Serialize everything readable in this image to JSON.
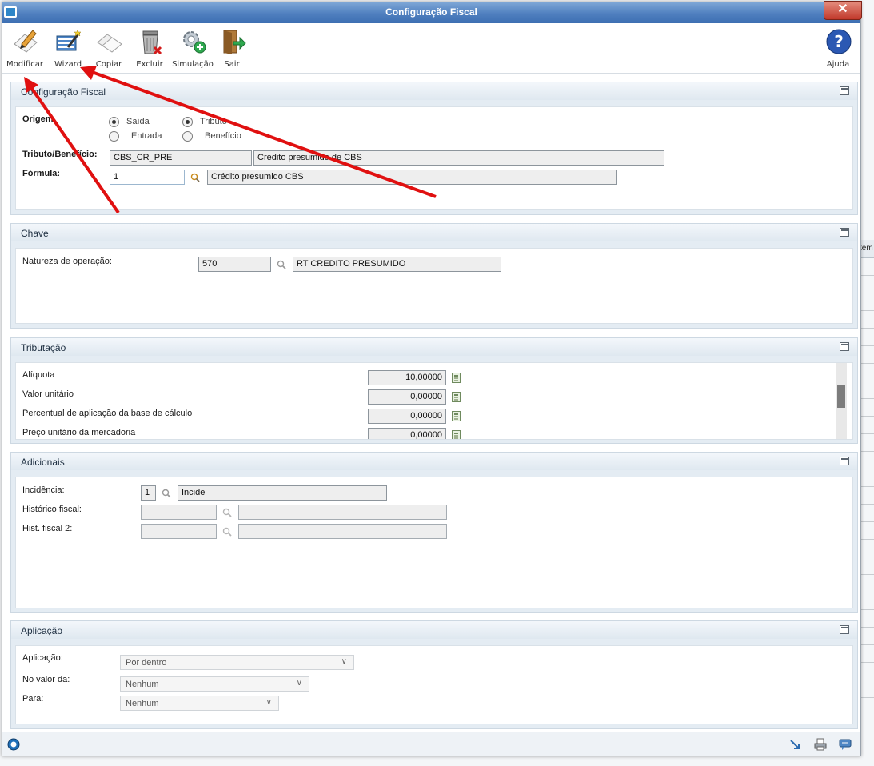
{
  "window": {
    "title": "Configuração Fiscal",
    "close_label": "✕"
  },
  "toolbar": {
    "items": [
      {
        "label": "Modificar",
        "icon": "edit-pencil-icon"
      },
      {
        "label": "Wizard",
        "icon": "wizard-wand-icon"
      },
      {
        "label": "Copiar",
        "icon": "copy-icon"
      },
      {
        "label": "Excluir",
        "icon": "trash-icon"
      },
      {
        "label": "Simulação",
        "icon": "gear-simulation-icon"
      },
      {
        "label": "Sair",
        "icon": "exit-door-icon"
      }
    ],
    "help_label": "Ajuda"
  },
  "background": {
    "right_header_fragment": "tem"
  },
  "panels": {
    "config": {
      "title": "Configuração Fiscal",
      "origem_label": "Origem",
      "radios": {
        "saida": "Saída",
        "entrada": "Entrada",
        "tributo": "Tributo",
        "beneficio": "Benefício"
      },
      "tributo_label": "Tributo/Benefício:",
      "tributo_code": "CBS_CR_PRE",
      "tributo_desc": "Crédito presumido de CBS",
      "formula_label": "Fórmula:",
      "formula_code": "1",
      "formula_desc": "Crédito presumido CBS"
    },
    "chave": {
      "title": "Chave",
      "natureza_label": "Natureza de operação:",
      "natureza_code": "570",
      "natureza_desc": "RT CREDITO PRESUMIDO"
    },
    "tributacao": {
      "title": "Tributação",
      "rows": [
        {
          "label": "Alíquota",
          "value": "10,00000"
        },
        {
          "label": "Valor unitário",
          "value": "0,00000"
        },
        {
          "label": "Percentual de aplicação da base de cálculo",
          "value": "0,00000"
        },
        {
          "label": "Preço unitário da mercadoria",
          "value": "0,00000"
        }
      ]
    },
    "adicionais": {
      "title": "Adicionais",
      "incidencia_label": "Incidência:",
      "incidencia_code": "1",
      "incidencia_desc": "Incide",
      "historico_label": "Histórico fiscal:",
      "hist2_label": "Hist. fiscal 2:"
    },
    "aplicacao": {
      "title": "Aplicação",
      "aplicacao_label": "Aplicação:",
      "aplicacao_value": "Por dentro",
      "novalor_label": "No valor da:",
      "novalor_value": "Nenhum",
      "para_label": "Para:",
      "para_value": "Nenhum"
    }
  },
  "colors": {
    "accent": "#3d6fb2",
    "arrow": "#e01010",
    "panel_bg": "#e4ecf3"
  }
}
